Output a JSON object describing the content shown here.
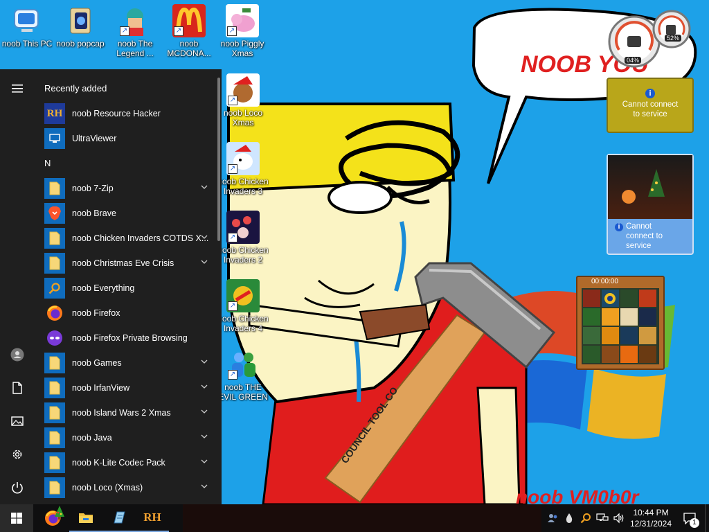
{
  "wallpaper": {
    "speech_text": "NOOB YOU",
    "signature_text": "noob VM0b0r",
    "hammer_handle_text": "COUNCIL TOOL CO"
  },
  "desktop_icons": [
    {
      "label": "noob This PC",
      "icon": "computer-icon"
    },
    {
      "label": "noob popcap",
      "icon": "popcap-folder-icon"
    },
    {
      "label": "noob The Legend ...",
      "icon": "legend-game-icon"
    },
    {
      "label": "noob MCDONA...",
      "icon": "mcdonalds-icon"
    },
    {
      "label": "noob Piggly Xmas",
      "icon": "piggly-icon"
    },
    {
      "label": "noob Loco Xmas",
      "icon": "loco-bear-icon"
    },
    {
      "label": "noob Chicken Invaders 3 X...",
      "icon": "chicken-invaders-icon"
    },
    {
      "label": "noob Chicken Invaders 2 X...",
      "icon": "chicken-invaders-icon"
    },
    {
      "label": "noob Chicken Invaders 4 X...",
      "icon": "chicken-invaders-icon"
    },
    {
      "label": "noob THE EVIL GREEN ...",
      "icon": "evil-green-icon"
    }
  ],
  "start_menu": {
    "recently_added_label": "Recently added",
    "recent": [
      {
        "label": "noob Resource Hacker",
        "icon": "resource-hacker-icon"
      },
      {
        "label": "UltraViewer",
        "icon": "ultraviewer-icon"
      }
    ],
    "letter": "N",
    "apps": [
      {
        "label": "noob 7-Zip",
        "icon": "folder-icon",
        "expand": true
      },
      {
        "label": "noob Brave",
        "icon": "brave-icon",
        "expand": false
      },
      {
        "label": "noob Chicken Invaders COTDS X...",
        "icon": "folder-icon",
        "expand": true
      },
      {
        "label": "noob Christmas Eve Crisis",
        "icon": "folder-icon",
        "expand": true
      },
      {
        "label": "noob Everything",
        "icon": "search-icon",
        "expand": false
      },
      {
        "label": "noob Firefox",
        "icon": "firefox-icon",
        "expand": false
      },
      {
        "label": "noob Firefox Private Browsing",
        "icon": "firefox-private-icon",
        "expand": false
      },
      {
        "label": "noob Games",
        "icon": "folder-icon",
        "expand": true
      },
      {
        "label": "noob IrfanView",
        "icon": "folder-icon",
        "expand": true
      },
      {
        "label": "noob Island Wars 2 Xmas",
        "icon": "folder-icon",
        "expand": true
      },
      {
        "label": "noob Java",
        "icon": "folder-icon",
        "expand": true
      },
      {
        "label": "noob K-Lite Codec Pack",
        "icon": "folder-icon",
        "expand": true
      },
      {
        "label": "noob Loco (Xmas)",
        "icon": "folder-icon",
        "expand": true
      }
    ]
  },
  "gadgets": {
    "cpu_percent": "04%",
    "memory_percent": "52%",
    "weather_message": "Cannot connect to service",
    "slideshow_message": "Cannot connect to service",
    "puzzle_timer": "00:00:00"
  },
  "taskbar": {
    "time": "10:44 PM",
    "date": "12/31/2024",
    "notification_count": "1",
    "pinned": [
      "firefox-icon",
      "file-explorer-icon",
      "notepad-icon",
      "resource-hacker-icon"
    ]
  },
  "colors": {
    "sky": "#1da1e8",
    "start_menu_bg": "#1f1f1f",
    "taskbar_bg": "#0f0f10",
    "folder_tile": "#0f6cbd",
    "accent_red": "#e02020"
  }
}
